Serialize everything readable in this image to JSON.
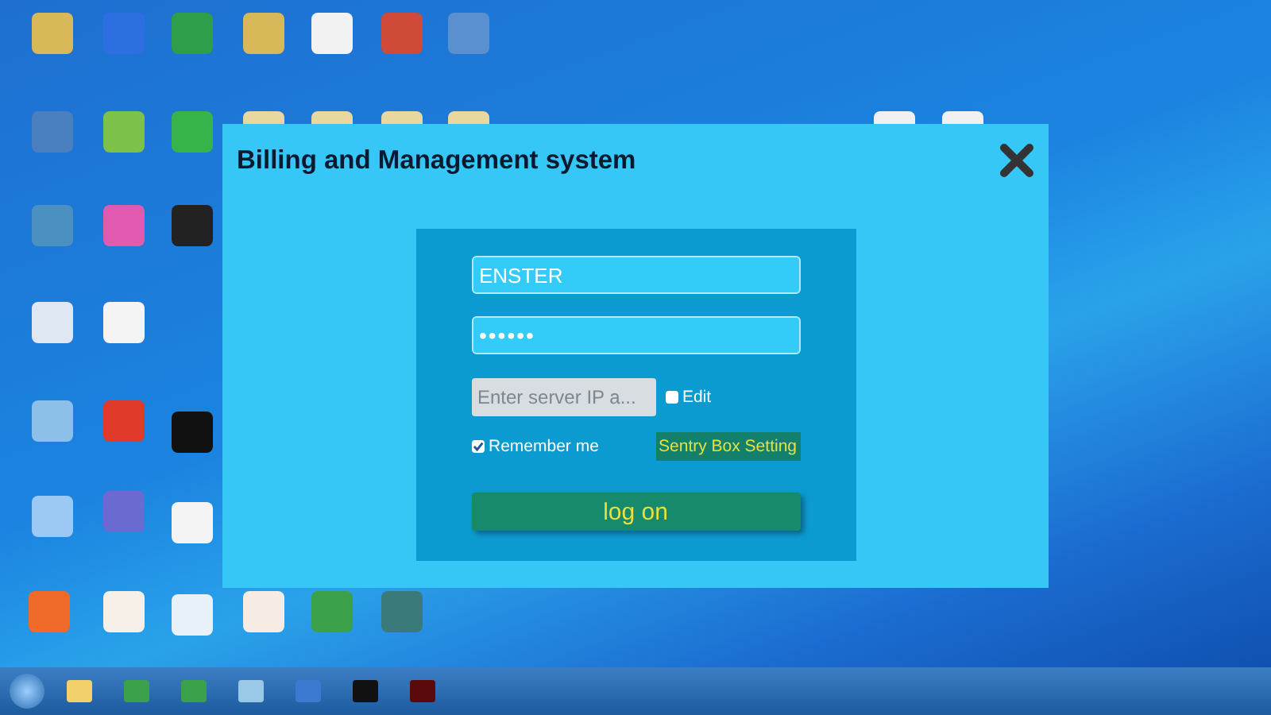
{
  "window": {
    "title": "Billing and Management system"
  },
  "login": {
    "username": {
      "value": "ENSTER"
    },
    "password": {
      "value": "••••••"
    },
    "server_ip": {
      "placeholder": "Enter server IP a..."
    },
    "edit": {
      "label": "Edit",
      "checked": false
    },
    "remember_me": {
      "label": "Remember me",
      "checked": true
    },
    "sentry_box_setting": {
      "label": "Sentry Box Setting"
    },
    "log_on": {
      "label": "log on"
    }
  }
}
